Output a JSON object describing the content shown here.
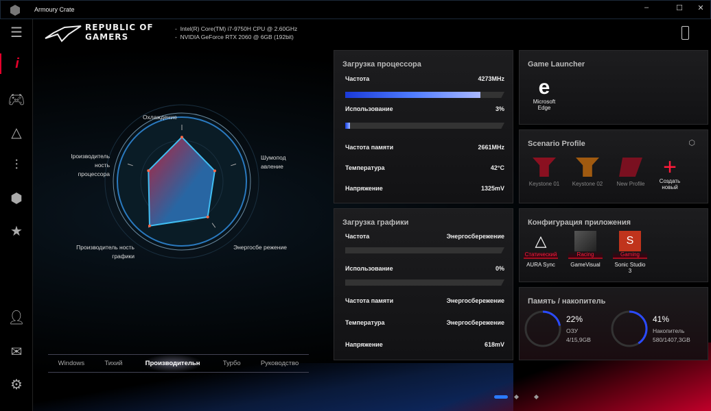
{
  "window": {
    "title": "Armoury Crate",
    "controls": [
      "minimize",
      "maximize",
      "close"
    ]
  },
  "header": {
    "brand": "REPUBLIC OF GAMERS",
    "specs": [
      "Intel(R) Core(TM) i7-9750H CPU @ 2.60GHz",
      "NVIDIA GeForce RTX 2060 @ 6GB (192bit)"
    ]
  },
  "sidebar": {
    "items": [
      "menu-icon",
      "info-icon",
      "gamepad-icon",
      "aura-icon",
      "sliders-icon",
      "box-icon",
      "star-icon",
      "user-icon",
      "mail-icon",
      "settings-icon"
    ],
    "active": "info-icon",
    "accent": "#e4002b"
  },
  "radar": {
    "labels": [
      "Охлаждение",
      "Шумопод авление",
      "Энергосбе режение",
      "Производитель ность графики",
      "Iроизводитель ность процессора"
    ],
    "values": [
      0.81,
      0.63,
      0.8,
      1.0,
      0.64
    ]
  },
  "modes": {
    "tabs": [
      "Windows",
      "Тихий",
      "Производительн",
      "Турбо",
      "Руководство"
    ],
    "active": 2
  },
  "cpu": {
    "title": "Загрузка процессора",
    "freq_label": "Частота",
    "freq": "4273MHz",
    "freq_pct": 85,
    "usage_label": "Использование",
    "usage": "3%",
    "usage_pct": 3,
    "mem_label": "Частота памяти",
    "mem": "2661MHz",
    "temp_label": "Температура",
    "temp": "42°C",
    "volt_label": "Напряжение",
    "volt": "1325mV"
  },
  "gpu": {
    "title": "Загрузка графики",
    "freq_label": "Частота",
    "freq": "Энергосбережение",
    "freq_pct": 0,
    "usage_label": "Использование",
    "usage": "0%",
    "usage_pct": 0,
    "mem_label": "Частота памяти",
    "mem": "Энергосбережение",
    "temp_label": "Температура",
    "temp": "Энергосбережение",
    "volt_label": "Напряжение",
    "volt": "618mV"
  },
  "launcher": {
    "title": "Game Launcher",
    "app": "Microsoft Edge"
  },
  "scenario": {
    "title": "Scenario Profile",
    "profiles": [
      "Keystone 01",
      "Keystone 02",
      "New Profile"
    ],
    "create": "Создать новый"
  },
  "appconfig": {
    "title": "Конфигурация приложения",
    "apps": [
      {
        "name": "AURA Sync",
        "mode": "Статический"
      },
      {
        "name": "GameVisual",
        "mode": "Racing"
      },
      {
        "name": "Sonic Studio 3",
        "mode": "Gaming"
      }
    ]
  },
  "storage": {
    "title": "Память / накопитель",
    "ram": {
      "pct": "22%",
      "value": 22,
      "label": "ОЗУ",
      "detail": "4/15,9GB"
    },
    "disk": {
      "pct": "41%",
      "value": 41,
      "label": "Накопитель",
      "detail": "580/1407,3GB"
    }
  },
  "pager": {
    "pages": 3,
    "active": 0
  }
}
